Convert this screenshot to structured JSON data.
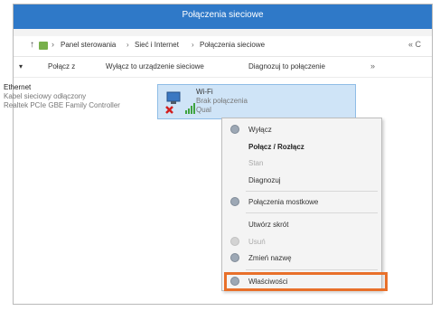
{
  "window": {
    "title": "Połączenia sieciowe"
  },
  "address": {
    "breadcrumb": [
      "Panel sterowania",
      "Sieć i Internet",
      "Połączenia sieciowe"
    ],
    "separator": "›",
    "up_glyph": "↑",
    "back_glyph": "›",
    "refresh_glyph": "« C"
  },
  "toolbar": {
    "dropdown_glyph": "▾",
    "items": [
      "Połącz z",
      "Wyłącz to urządzenie sieciowe",
      "Diagnozuj to połączenie"
    ],
    "more": "»"
  },
  "connections": {
    "ethernet": {
      "name": "Ethernet",
      "status": "Kabel sieciowy odłączony",
      "device": "Realtek PCIe GBE Family Controller"
    },
    "wifi": {
      "name": "Wi-Fi",
      "status": "Brak połączenia",
      "device": "Qual"
    }
  },
  "context_menu": {
    "items": [
      {
        "label": "Wyłącz",
        "icon": "shield-icon",
        "bold": false,
        "enabled": true
      },
      {
        "label": "Połącz / Rozłącz",
        "icon": "",
        "bold": true,
        "enabled": true
      },
      {
        "label": "Stan",
        "icon": "",
        "bold": false,
        "enabled": false
      },
      {
        "label": "Diagnozuj",
        "icon": "",
        "bold": false,
        "enabled": true
      },
      {
        "label": "Połączenia mostkowe",
        "icon": "shield-icon",
        "bold": false,
        "enabled": true
      },
      {
        "label": "Utwórz skrót",
        "icon": "",
        "bold": false,
        "enabled": true
      },
      {
        "label": "Usuń",
        "icon": "shield-icon",
        "bold": false,
        "enabled": false
      },
      {
        "label": "Zmień nazwę",
        "icon": "shield-icon",
        "bold": false,
        "enabled": true
      },
      {
        "label": "Właściwości",
        "icon": "shield-icon",
        "bold": false,
        "enabled": true
      }
    ],
    "highlighted_item": "Właściwości",
    "highlight_color": "#e8702a"
  },
  "colors": {
    "titlebar": "#2f79c8",
    "selection": "#cfe4f7"
  }
}
